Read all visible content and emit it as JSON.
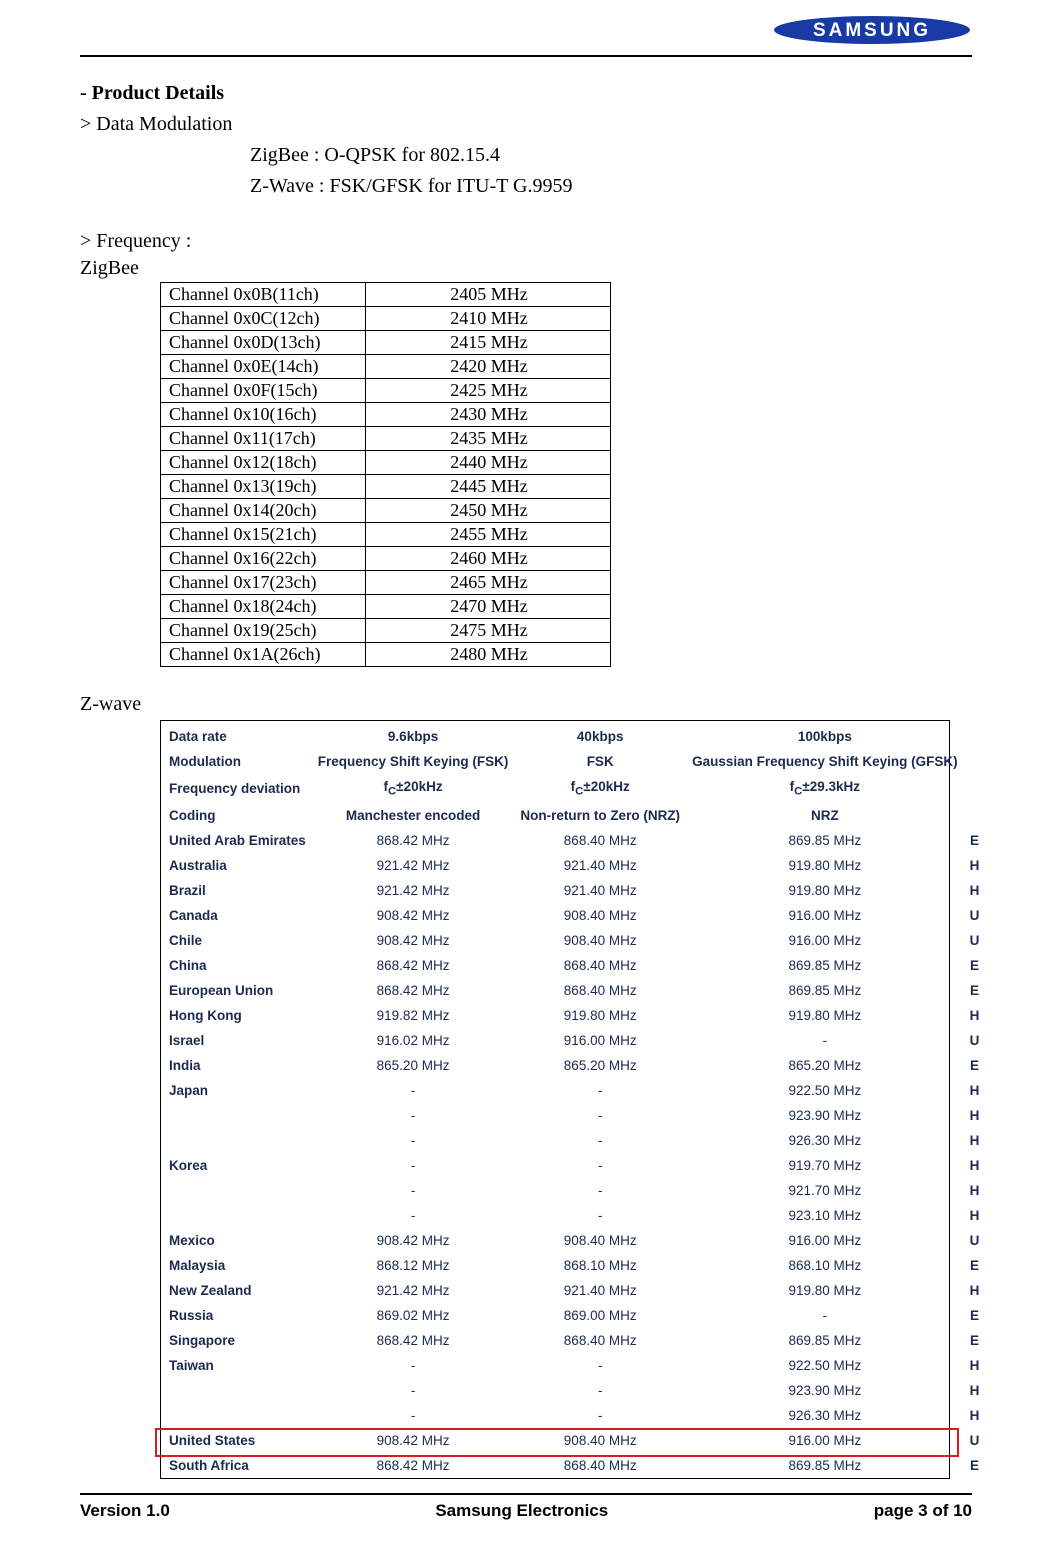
{
  "header": {
    "brand": "SAMSUNG"
  },
  "title": "- Product Details",
  "modulation": {
    "heading": "> Data Modulation",
    "lines": [
      "ZigBee : O-QPSK for 802.15.4",
      "Z-Wave : FSK/GFSK for ITU-T G.9959"
    ]
  },
  "frequency_heading": "> Frequency :",
  "zigbee": {
    "label": "ZigBee",
    "rows": [
      {
        "ch": "Channel 0x0B(11ch)",
        "freq": "2405 MHz"
      },
      {
        "ch": "Channel 0x0C(12ch)",
        "freq": "2410 MHz"
      },
      {
        "ch": "Channel 0x0D(13ch)",
        "freq": "2415 MHz"
      },
      {
        "ch": "Channel 0x0E(14ch)",
        "freq": "2420 MHz"
      },
      {
        "ch": "Channel 0x0F(15ch)",
        "freq": "2425 MHz"
      },
      {
        "ch": "Channel 0x10(16ch)",
        "freq": "2430 MHz"
      },
      {
        "ch": "Channel 0x11(17ch)",
        "freq": "2435 MHz"
      },
      {
        "ch": "Channel 0x12(18ch)",
        "freq": "2440 MHz"
      },
      {
        "ch": "Channel 0x13(19ch)",
        "freq": "2445 MHz"
      },
      {
        "ch": "Channel 0x14(20ch)",
        "freq": "2450 MHz"
      },
      {
        "ch": "Channel 0x15(21ch)",
        "freq": "2455 MHz"
      },
      {
        "ch": "Channel 0x16(22ch)",
        "freq": "2460 MHz"
      },
      {
        "ch": "Channel 0x17(23ch)",
        "freq": "2465 MHz"
      },
      {
        "ch": "Channel 0x18(24ch)",
        "freq": "2470 MHz"
      },
      {
        "ch": "Channel 0x19(25ch)",
        "freq": "2475 MHz"
      },
      {
        "ch": "Channel 0x1A(26ch)",
        "freq": "2480 MHz"
      }
    ]
  },
  "zwave": {
    "label": "Z-wave",
    "head": {
      "datarate": {
        "lbl": "Data rate",
        "c1": "9.6kbps",
        "c2": "40kbps",
        "c3": "100kbps"
      },
      "mod": {
        "lbl": "Modulation",
        "c1": "Frequency Shift Keying (FSK)",
        "c2": "FSK",
        "c3": "Gaussian Frequency Shift Keying (GFSK)"
      },
      "fdev_lbl": "Frequency deviation",
      "fdev_c1_pre": "f",
      "fdev_c1_sub": "C",
      "fdev_c1_post": "±20kHz",
      "fdev_c2_pre": "f",
      "fdev_c2_sub": "C",
      "fdev_c2_post": "±20kHz",
      "fdev_c3_pre": "f",
      "fdev_c3_sub": "C",
      "fdev_c3_post": "±29.3kHz",
      "coding": {
        "lbl": "Coding",
        "c1": "Manchester encoded",
        "c2": "Non-return to Zero (NRZ)",
        "c3": "NRZ"
      }
    },
    "rows": [
      {
        "lbl": "United Arab Emirates",
        "c1": "868.42 MHz",
        "c2": "868.40 MHz",
        "c3": "869.85 MHz",
        "flag": "E"
      },
      {
        "lbl": "Australia",
        "c1": "921.42 MHz",
        "c2": "921.40 MHz",
        "c3": "919.80 MHz",
        "flag": "H"
      },
      {
        "lbl": "Brazil",
        "c1": "921.42 MHz",
        "c2": "921.40 MHz",
        "c3": "919.80 MHz",
        "flag": "H"
      },
      {
        "lbl": "Canada",
        "c1": "908.42 MHz",
        "c2": "908.40 MHz",
        "c3": "916.00 MHz",
        "flag": "U"
      },
      {
        "lbl": "Chile",
        "c1": "908.42 MHz",
        "c2": "908.40 MHz",
        "c3": "916.00 MHz",
        "flag": "U"
      },
      {
        "lbl": "China",
        "c1": "868.42 MHz",
        "c2": "868.40 MHz",
        "c3": "869.85 MHz",
        "flag": "E"
      },
      {
        "lbl": "European Union",
        "c1": "868.42 MHz",
        "c2": "868.40 MHz",
        "c3": "869.85 MHz",
        "flag": "E"
      },
      {
        "lbl": "Hong Kong",
        "c1": "919.82 MHz",
        "c2": "919.80 MHz",
        "c3": "919.80 MHz",
        "flag": "H"
      },
      {
        "lbl": "Israel",
        "c1": "916.02 MHz",
        "c2": "916.00 MHz",
        "c3": "-",
        "flag": "U"
      },
      {
        "lbl": "India",
        "c1": "865.20 MHz",
        "c2": "865.20 MHz",
        "c3": "865.20 MHz",
        "flag": "E"
      },
      {
        "lbl": "Japan",
        "c1": "-",
        "c2": "-",
        "c3": "922.50 MHz",
        "flag": "H"
      },
      {
        "lbl": "",
        "c1": "-",
        "c2": "-",
        "c3": "923.90 MHz",
        "flag": "H"
      },
      {
        "lbl": "",
        "c1": "-",
        "c2": "-",
        "c3": "926.30 MHz",
        "flag": "H"
      },
      {
        "lbl": "Korea",
        "c1": "-",
        "c2": "-",
        "c3": "919.70 MHz",
        "flag": "H"
      },
      {
        "lbl": "",
        "c1": "-",
        "c2": "-",
        "c3": "921.70 MHz",
        "flag": "H"
      },
      {
        "lbl": "",
        "c1": "-",
        "c2": "-",
        "c3": "923.10 MHz",
        "flag": "H"
      },
      {
        "lbl": "Mexico",
        "c1": "908.42 MHz",
        "c2": "908.40 MHz",
        "c3": "916.00 MHz",
        "flag": "U"
      },
      {
        "lbl": "Malaysia",
        "c1": "868.12 MHz",
        "c2": "868.10 MHz",
        "c3": "868.10 MHz",
        "flag": "E"
      },
      {
        "lbl": "New Zealand",
        "c1": "921.42 MHz",
        "c2": "921.40 MHz",
        "c3": "919.80 MHz",
        "flag": "H"
      },
      {
        "lbl": "Russia",
        "c1": "869.02 MHz",
        "c2": "869.00 MHz",
        "c3": "-",
        "flag": "E"
      },
      {
        "lbl": "Singapore",
        "c1": "868.42 MHz",
        "c2": "868.40 MHz",
        "c3": "869.85 MHz",
        "flag": "E"
      },
      {
        "lbl": "Taiwan",
        "c1": "-",
        "c2": "-",
        "c3": "922.50 MHz",
        "flag": "H"
      },
      {
        "lbl": "",
        "c1": "-",
        "c2": "-",
        "c3": "923.90 MHz",
        "flag": "H"
      },
      {
        "lbl": "",
        "c1": "-",
        "c2": "-",
        "c3": "926.30 MHz",
        "flag": "H"
      },
      {
        "lbl": "United States",
        "c1": "908.42 MHz",
        "c2": "908.40 MHz",
        "c3": "916.00 MHz",
        "flag": "U",
        "highlight": true
      },
      {
        "lbl": "South Africa",
        "c1": "868.42 MHz",
        "c2": "868.40 MHz",
        "c3": "869.85 MHz",
        "flag": "E"
      }
    ]
  },
  "footer": {
    "version": "Version 1.0",
    "company": "Samsung Electronics",
    "page": "page 3 of 10"
  }
}
